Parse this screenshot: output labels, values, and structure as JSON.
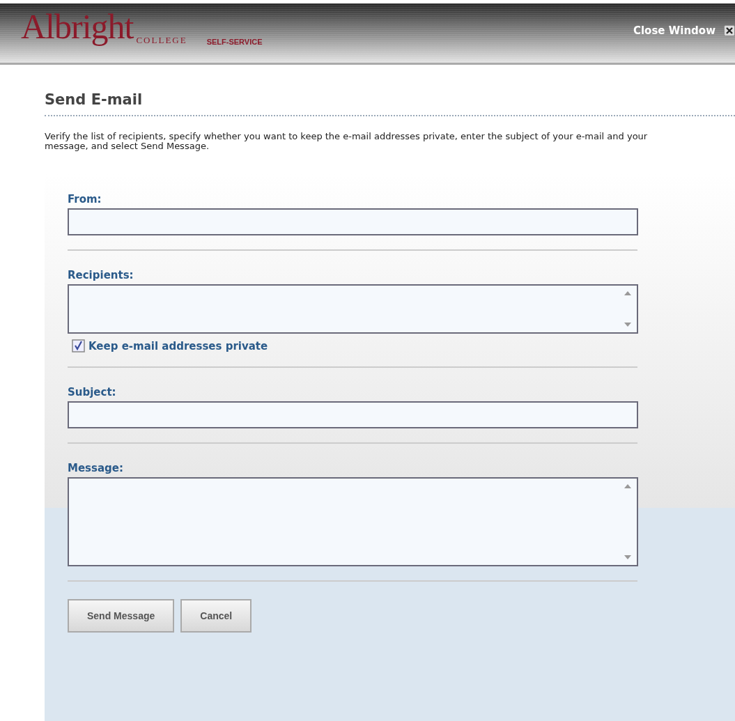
{
  "header": {
    "logo": "Albright",
    "logo_sub": "COLLEGE",
    "product": "SELF-SERVICE",
    "close_label": "Close Window"
  },
  "page": {
    "title": "Send E-mail",
    "description": "Verify the list of recipients, specify whether you want to keep the e-mail addresses private, enter the subject of your e-mail and your message, and select Send Message."
  },
  "form": {
    "sections": [
      {
        "kind": "input",
        "label": "From:"
      },
      {
        "kind": "textarea",
        "label": "Recipients:",
        "checkbox": {
          "label": "Keep e-mail addresses private",
          "checked": true
        }
      },
      {
        "kind": "input",
        "label": "Subject:"
      },
      {
        "kind": "large-textarea",
        "label": "Message:"
      }
    ],
    "buttons": [
      {
        "label": "Send Message"
      },
      {
        "label": "Cancel"
      }
    ]
  }
}
